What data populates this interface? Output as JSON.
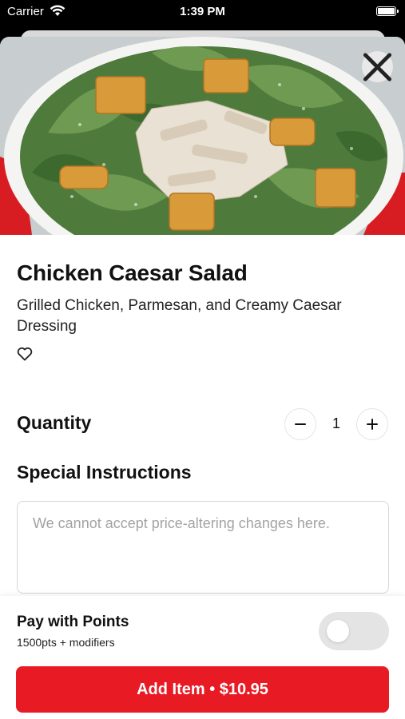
{
  "status_bar": {
    "carrier": "Carrier",
    "time": "1:39 PM"
  },
  "item": {
    "name": "Chicken Caesar Salad",
    "description": "Grilled Chicken, Parmesan, and Creamy Caesar Dressing",
    "image_icon": "caesar-salad-photo"
  },
  "quantity": {
    "label": "Quantity",
    "value": "1",
    "minus_icon": "minus-icon",
    "plus_icon": "plus-icon"
  },
  "special_instructions": {
    "label": "Special Instructions",
    "placeholder": "We cannot accept price-altering changes here.",
    "value": ""
  },
  "points": {
    "label": "Pay with Points",
    "detail": "1500pts + modifiers",
    "toggle_on": false
  },
  "cta": {
    "label": "Add Item • $10.95"
  },
  "colors": {
    "accent": "#e81a24",
    "toggle_off": "#e4e4e4"
  }
}
